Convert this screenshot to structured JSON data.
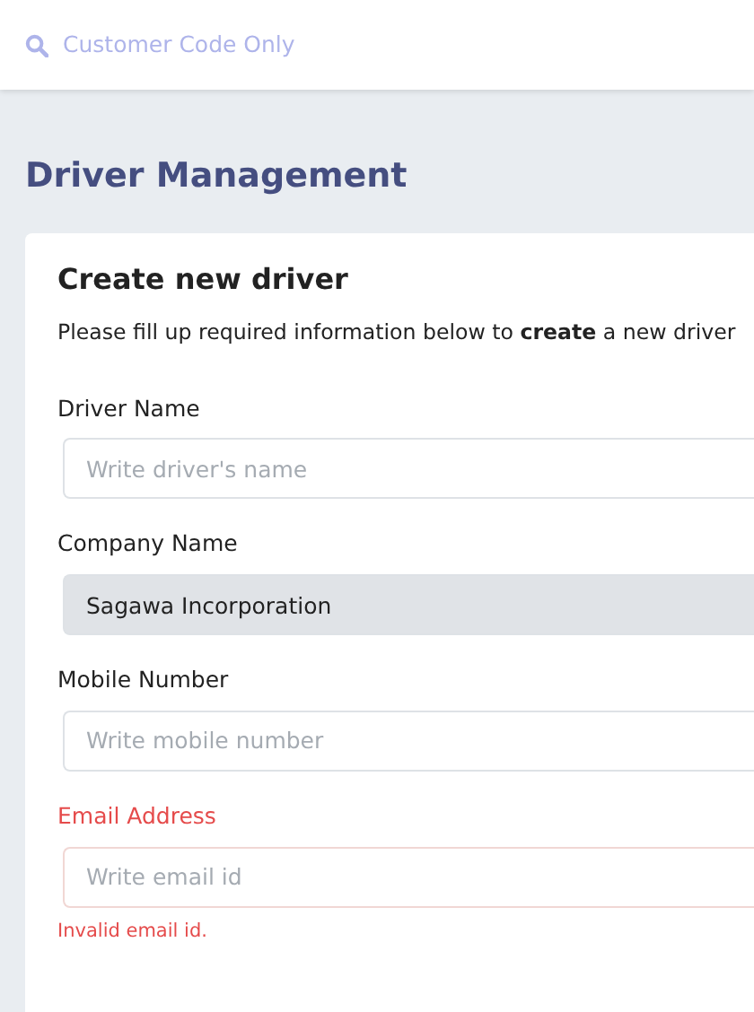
{
  "search": {
    "placeholder": "Customer Code Only"
  },
  "page_title": "Driver Management",
  "card": {
    "title": "Create new driver",
    "description": "Please fill up required information below to **create** a new driver",
    "fields": [
      {
        "label": "Driver Name",
        "placeholder": "Write driver's name",
        "disabled": false,
        "invalid": false
      },
      {
        "label": "Company Name",
        "value": "Sagawa Incorporation",
        "disabled": true,
        "invalid": false
      },
      {
        "label": "Mobile Number",
        "placeholder": "Write mobile number",
        "disabled": false,
        "invalid": false
      },
      {
        "label": "Email Address",
        "placeholder": "Write email id",
        "disabled": false,
        "invalid": true,
        "error": "Invalid email id."
      }
    ]
  }
}
